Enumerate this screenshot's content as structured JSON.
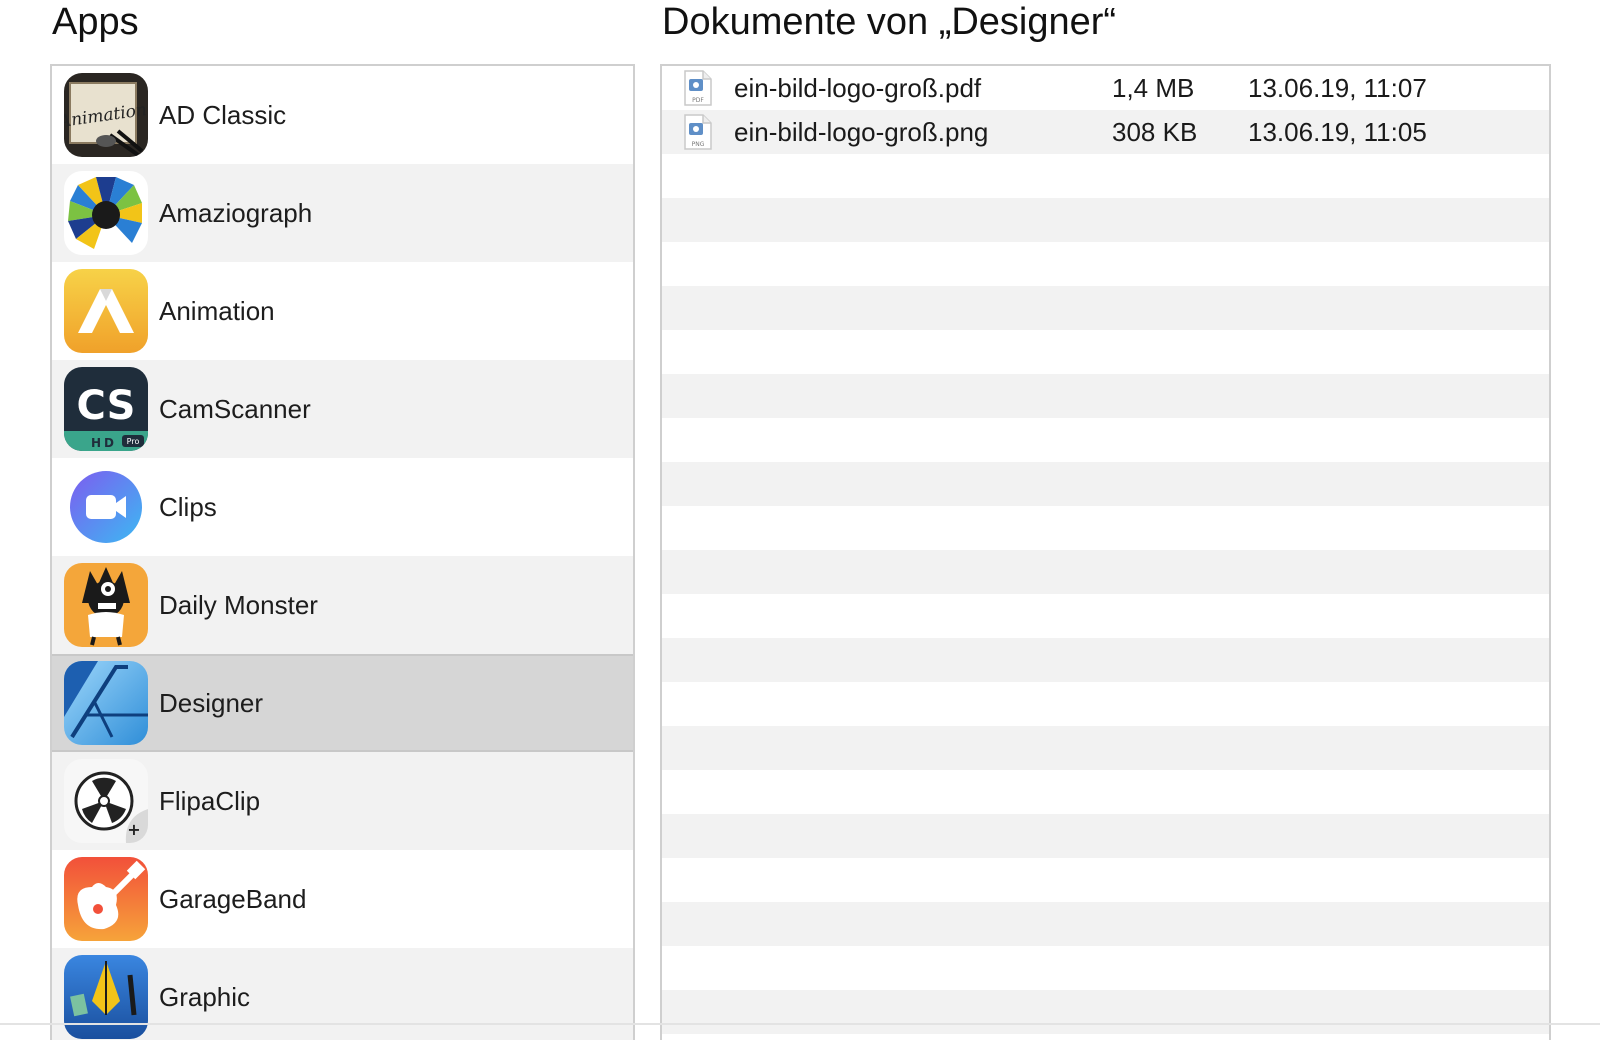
{
  "apps_header": {
    "title": "Apps"
  },
  "docs_header": {
    "title": "Dokumente von „Designer“"
  },
  "apps": [
    {
      "name": "AD Classic",
      "icon": "ad-classic-icon",
      "badge": "Animation"
    },
    {
      "name": "Amaziograph",
      "icon": "amaziograph-icon"
    },
    {
      "name": "Animation",
      "icon": "animation-icon"
    },
    {
      "name": "CamScanner",
      "icon": "camscanner-icon",
      "badge": "CS",
      "badge_sub": "HD",
      "badge_pro": "Pro"
    },
    {
      "name": "Clips",
      "icon": "clips-icon"
    },
    {
      "name": "Daily Monster",
      "icon": "daily-monster-icon"
    },
    {
      "name": "Designer",
      "icon": "designer-icon",
      "selected": true
    },
    {
      "name": "FlipaClip",
      "icon": "flipaclip-icon"
    },
    {
      "name": "GarageBand",
      "icon": "garageband-icon"
    },
    {
      "name": "Graphic",
      "icon": "graphic-icon"
    }
  ],
  "documents": [
    {
      "name": "ein-bild-logo-groß.pdf",
      "size": "1,4 MB",
      "date": "13.06.19, 11:07",
      "icon": "pdf-file-icon",
      "type_label": "PDF"
    },
    {
      "name": "ein-bild-logo-groß.png",
      "size": "308 KB",
      "date": "13.06.19, 11:05",
      "icon": "png-file-icon",
      "type_label": "PNG"
    }
  ],
  "colors": {
    "row_alt": "#f2f2f2",
    "selected_row": "#d6d6d6",
    "border": "#cfcfcf"
  }
}
